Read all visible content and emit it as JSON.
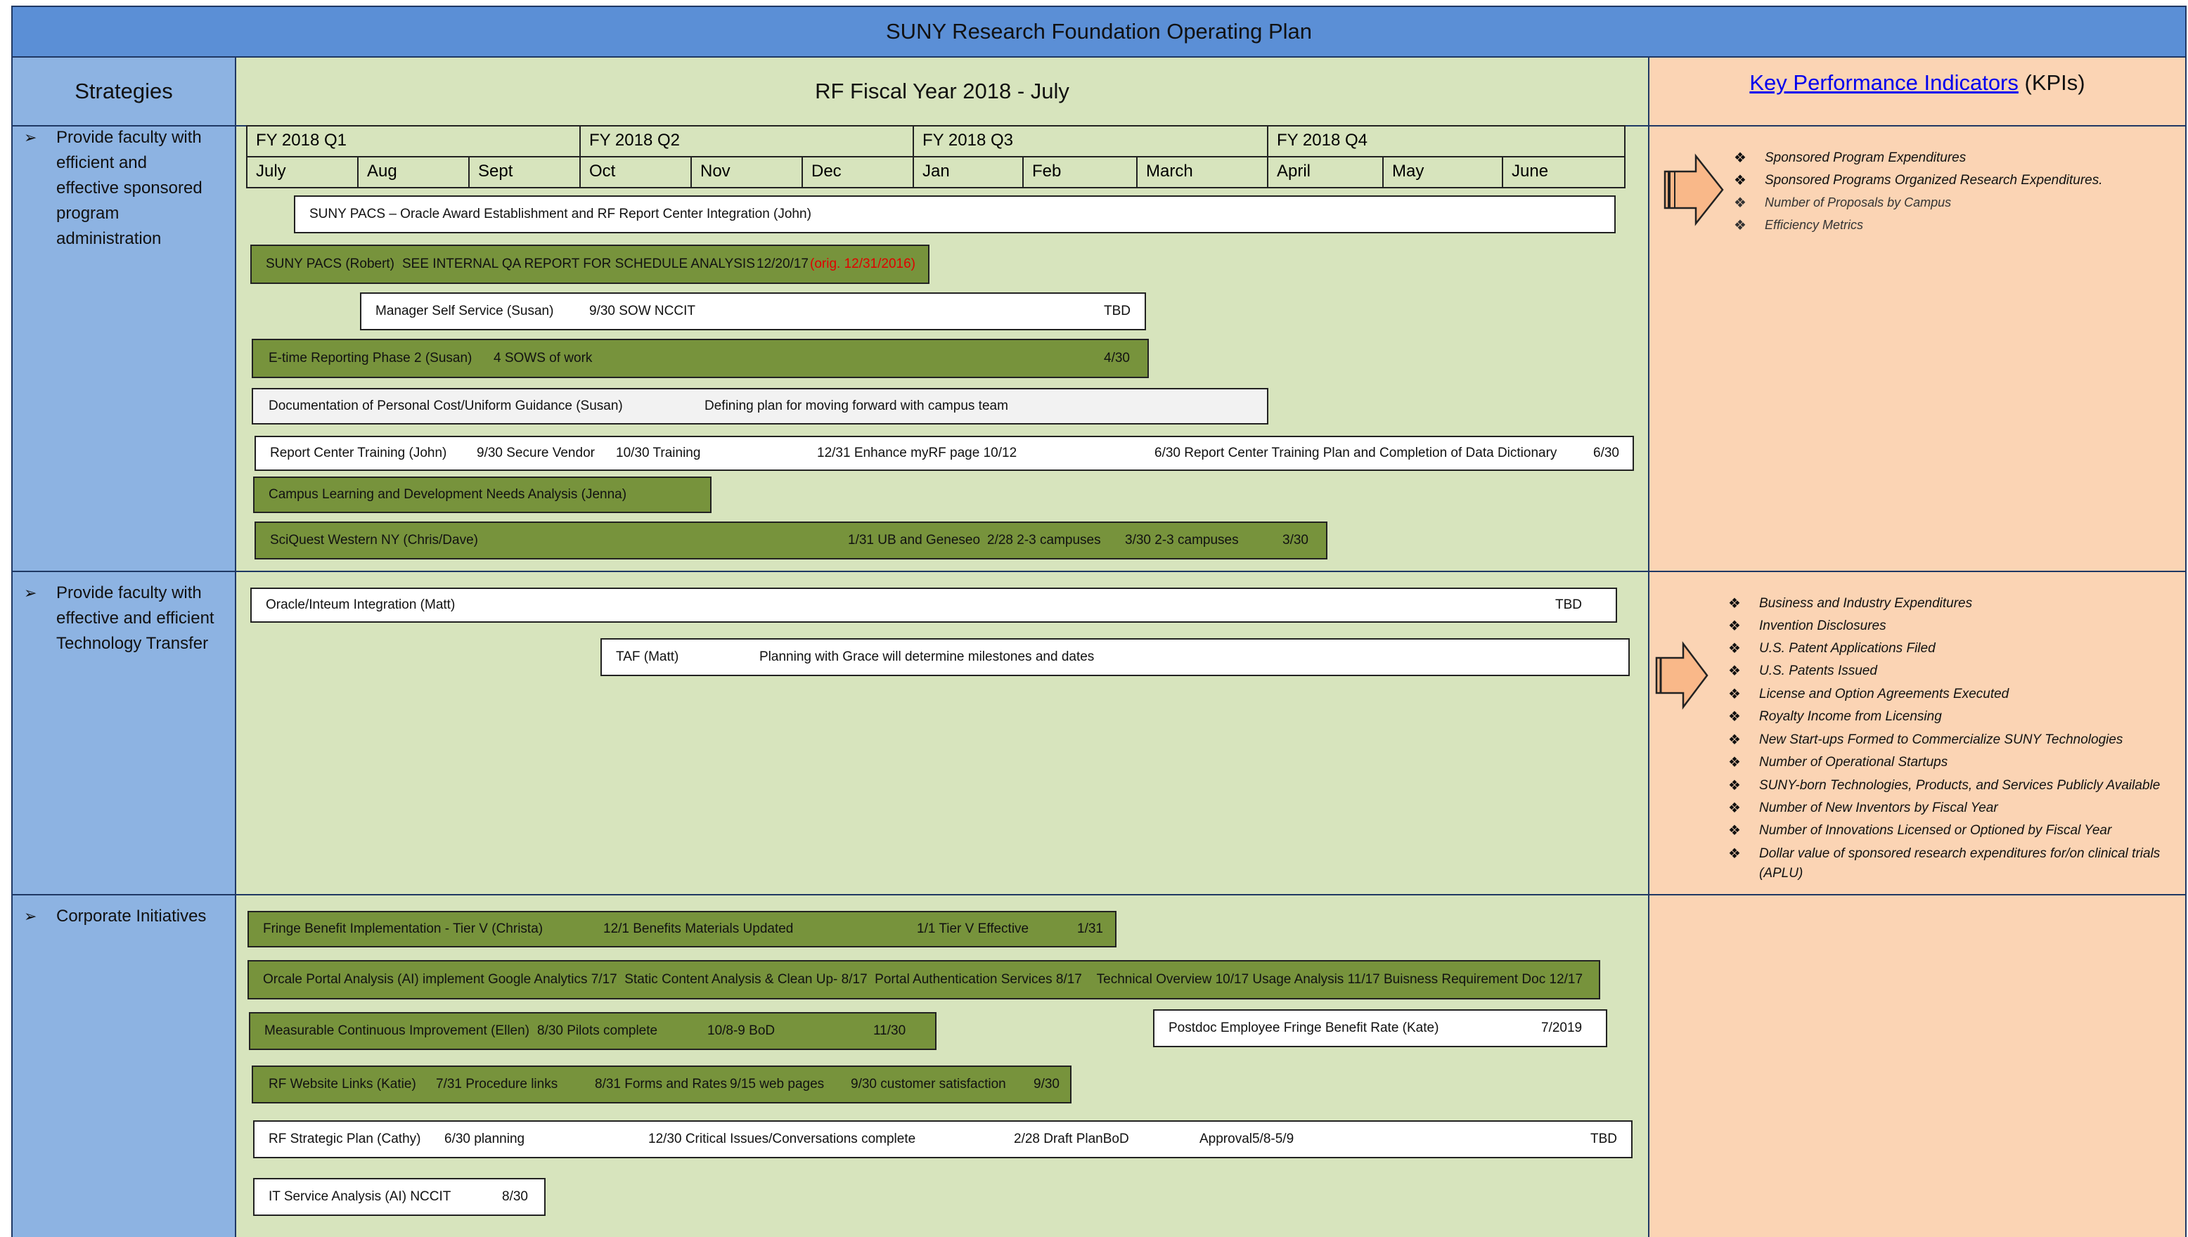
{
  "title": "SUNY Research Foundation Operating Plan",
  "headers": {
    "strategies": "Strategies",
    "fiscal_year": "RF Fiscal Year 2018 - July",
    "kpi_link": "Key Performance Indicators",
    "kpi_suffix": " (KPIs)"
  },
  "quarters": [
    "FY 2018 Q1",
    "FY 2018 Q2",
    "FY 2018 Q3",
    "FY 2018 Q4"
  ],
  "months": [
    "July",
    "Aug",
    "Sept",
    "Oct",
    "Nov",
    "Dec",
    "Jan",
    "Feb",
    "March",
    "April",
    "May",
    "June"
  ],
  "strategies": [
    "Provide faculty with efficient and effective sponsored program administration",
    "Provide faculty with effective and efficient Technology Transfer",
    "Corporate Initiatives"
  ],
  "bullet_glyph": "➢",
  "kpi_glyph": "❖",
  "section1": {
    "pacs_oracle": "SUNY PACS – Oracle Award Establishment and RF Report Center Integration (John)",
    "pacs_robert_a": "SUNY PACS (Robert)",
    "pacs_robert_b": "SEE INTERNAL QA REPORT FOR SCHEDULE ANALYSIS",
    "pacs_robert_c": "12/20/17",
    "pacs_robert_red": "(orig. 12/31/2016)",
    "mss_a": "Manager Self Service (Susan)",
    "mss_b": "9/30 SOW NCCIT",
    "mss_c": "TBD",
    "etime_a": "E-time Reporting Phase 2 (Susan)",
    "etime_b": "4 SOWS of work",
    "etime_c": "4/30",
    "doc_a": "Documentation of Personal Cost/Uniform Guidance (Susan)",
    "doc_b": "Defining plan for moving forward with campus team",
    "rct_a": "Report Center Training (John)",
    "rct_b": "9/30 Secure Vendor",
    "rct_c": "10/30 Training",
    "rct_d": "12/31 Enhance myRF page 10/12",
    "rct_e": "6/30 Report Center Training Plan and Completion of Data Dictionary",
    "rct_f": "6/30",
    "campus": "Campus Learning and Development Needs Analysis (Jenna)",
    "sci_a": "SciQuest Western NY (Chris/Dave)",
    "sci_b": "1/31 UB and Geneseo",
    "sci_c": "2/28 2-3 campuses",
    "sci_d": "3/30 2-3 campuses",
    "sci_e": "3/30"
  },
  "section2": {
    "oracle_a": "Oracle/Inteum Integration (Matt)",
    "oracle_b": "TBD",
    "taf_a": "TAF (Matt)",
    "taf_b": "Planning with Grace will determine milestones and dates"
  },
  "section3": {
    "fringe_a": "Fringe Benefit Implementation - Tier V (Christa)",
    "fringe_b": "12/1 Benefits Materials Updated",
    "fringe_c": "1/1 Tier V Effective",
    "fringe_d": "1/31",
    "orcale": "Orcale Portal Analysis (AI) implement Google Analytics 7/17  Static Content Analysis & Clean Up- 8/17  Portal Authentication Services 8/17    Technical Overview 10/17 Usage Analysis 11/17 Buisness Requirement Doc 12/17",
    "mci_a": "Measurable Continuous Improvement (Ellen)",
    "mci_b": "8/30 Pilots complete",
    "mci_c": "10/8-9  BoD",
    "mci_d": "11/30",
    "postdoc_a": "Postdoc Employee Fringe Benefit Rate (Kate)",
    "postdoc_b": "7/2019",
    "web_a": "RF Website Links (Katie)",
    "web_b": "7/31 Procedure links",
    "web_c": "8/31 Forms and Rates",
    "web_d": "9/15 web pages",
    "web_e": "9/30 customer satisfaction",
    "web_f": "9/30",
    "plan_a": "RF Strategic Plan (Cathy)",
    "plan_b": "6/30 planning",
    "plan_c": "12/30 Critical Issues/Conversations complete",
    "plan_d": "2/28 Draft PlanBoD",
    "plan_e": "Approval5/8-5/9",
    "plan_f": "TBD",
    "it_a": "IT Service Analysis (AI)  NCCIT",
    "it_b": "8/30"
  },
  "kpis1": [
    "Sponsored Program Expenditures",
    "Sponsored Programs Organized Research Expenditures.",
    "Number of Proposals by Campus",
    "Efficiency Metrics"
  ],
  "kpis2": [
    "Business and Industry Expenditures",
    "Invention Disclosures",
    "U.S. Patent Applications Filed",
    "U.S. Patents Issued",
    "License and Option Agreements Executed",
    "Royalty Income from Licensing",
    "New Start-ups Formed to Commercialize SUNY Technologies",
    "Number of Operational Startups",
    "SUNY-born Technologies, Products, and Services Publicly Available",
    "Number of New Inventors by Fiscal Year",
    "Number of Innovations Licensed or Optioned by Fiscal Year",
    "Dollar value of sponsored research expenditures for/on clinical trials",
    "(APLU)"
  ],
  "colors": {
    "title_bg": "#5b8fd6",
    "strategy_bg": "#8db3e2",
    "timeline_bg": "#d7e4bd",
    "kpi_bg": "#fbd4b4",
    "bar_green": "#77933c",
    "late_red": "#e00000",
    "arrow_fill": "#f9b889"
  }
}
